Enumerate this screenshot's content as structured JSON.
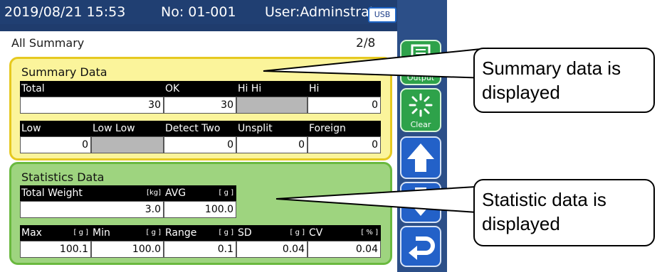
{
  "header": {
    "datetime": "2019/08/21 15:53",
    "number": "No: 01-001",
    "user": "User:Adminstrator",
    "usb_label": "USB"
  },
  "tab": {
    "label": "All Summary",
    "page": "2/8"
  },
  "summary": {
    "title": "Summary Data",
    "row1": [
      {
        "label": "Total",
        "value": "30"
      },
      {
        "label": "OK",
        "value": "30"
      },
      {
        "label": "Hi Hi",
        "value": ""
      },
      {
        "label": "Hi",
        "value": "0"
      }
    ],
    "row2": [
      {
        "label": "Low",
        "value": "0"
      },
      {
        "label": "Low Low",
        "value": ""
      },
      {
        "label": "Detect Two",
        "value": "0"
      },
      {
        "label": "Unsplit",
        "value": "0"
      },
      {
        "label": "Foreign",
        "value": "0"
      }
    ]
  },
  "statistics": {
    "title": "Statistics Data",
    "total_weight": {
      "label": "Total Weight",
      "unit": "[kg]",
      "value": "3.0"
    },
    "avg": {
      "label": "AVG",
      "unit": "[ g ]",
      "value": "100.0"
    },
    "row2": [
      {
        "label": "Max",
        "unit": "[ g ]",
        "value": "100.1"
      },
      {
        "label": "Min",
        "unit": "[ g ]",
        "value": "100.0"
      },
      {
        "label": "Range",
        "unit": "[ g ]",
        "value": "0.1"
      },
      {
        "label": "SD",
        "unit": "[ g ]",
        "value": "0.04"
      },
      {
        "label": "CV",
        "unit": "[ % ]",
        "value": "0.04"
      }
    ]
  },
  "sidebar": {
    "output_label": "Output",
    "clear_label": "Clear",
    "icons": [
      "printer-icon",
      "clear-sparkle-icon",
      "arrow-up-icon",
      "arrow-down-icon",
      "return-icon"
    ]
  },
  "callouts": {
    "summary_note": "Summary data is displayed",
    "statistic_note": "Statistic data is displayed"
  },
  "colors": {
    "header_bg": "#203f72",
    "summary_panel": "#fbf49b",
    "summary_border": "#e6c920",
    "stats_panel": "#9ed47f",
    "stats_border": "#6ab93f",
    "button_green": "#2ea24a",
    "button_blue": "#2361c8"
  }
}
